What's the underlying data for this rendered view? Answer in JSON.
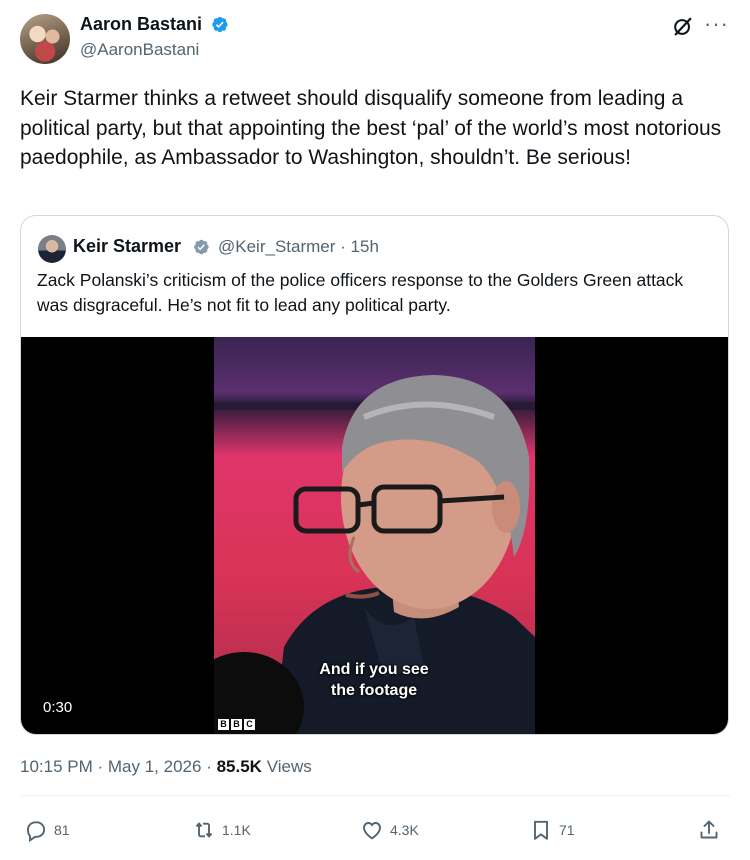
{
  "author": {
    "name": "Aaron Bastani",
    "handle": "@AaronBastani"
  },
  "tweet_text": "Keir Starmer thinks a retweet should disqualify someone from leading a political party, but that appointing the best ‘pal’ of the world’s most notorious paedophile, as Ambassador to Washington, shouldn’t.  Be serious!",
  "quote": {
    "name": "Keir Starmer",
    "handle": "@Keir_Starmer",
    "age": "15h",
    "text": "Zack Polanski’s criticism of the police officers response to the Golders Green attack was disgraceful.  He’s not fit to lead any political party.",
    "video": {
      "caption_line1": "And if you see",
      "caption_line2": "the footage",
      "duration": "0:30",
      "broadcaster": [
        "B",
        "B",
        "C"
      ]
    }
  },
  "meta": {
    "time": "10:15 PM",
    "date": "May 1, 2026",
    "views_count": "85.5K",
    "views_label": "Views"
  },
  "actions": {
    "replies": "81",
    "reposts": "1.1K",
    "likes": "4.3K",
    "bookmarks": "71"
  },
  "colors": {
    "text": "#0f1419",
    "secondary": "#536471",
    "verified": "#1d9bf0",
    "border": "#cfd9de"
  }
}
